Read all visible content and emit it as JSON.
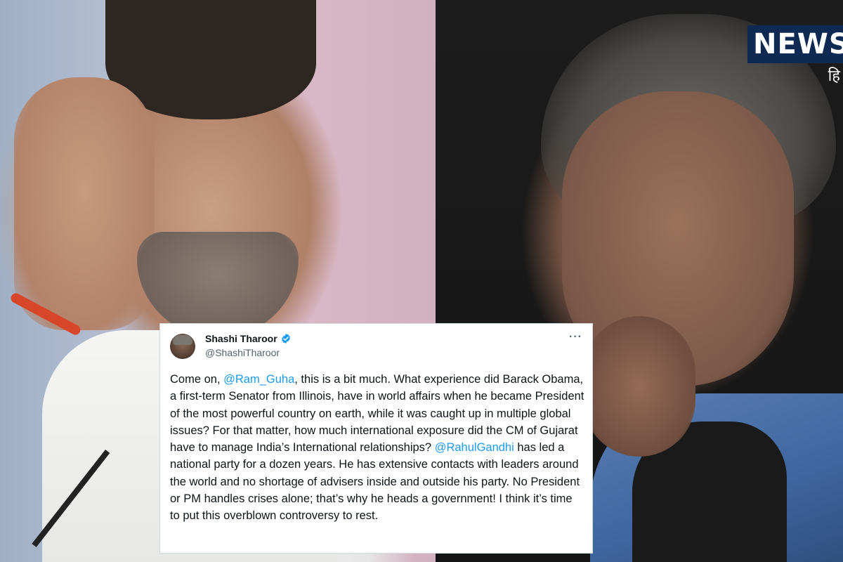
{
  "logo": {
    "text": "NEWS",
    "subtext": "हि"
  },
  "tweet": {
    "display_name": "Shashi Tharoor",
    "handle": "@ShashiTharoor",
    "verified_color": "#1d9bf0",
    "text_parts": [
      "Come on, ",
      "@Ram_Guha",
      ", this is a bit much. What experience did Barack Obama, a first-term Senator from Illinois, have in world affairs when he became President of the most powerful country on earth, while it was caught up in multiple global issues? For that matter, how much international exposure did the CM of Gujarat have to manage India’s International relationships? ",
      "@RahulGandhi",
      " has led a national party for a dozen years. He has extensive contacts with leaders around the world and no shortage of advisers inside and outside his party. No President or PM handles crises alone; that’s why he heads a government! I think it’s time to put this overblown controversy to rest."
    ],
    "more_icon": "more-horizontal-icon"
  }
}
